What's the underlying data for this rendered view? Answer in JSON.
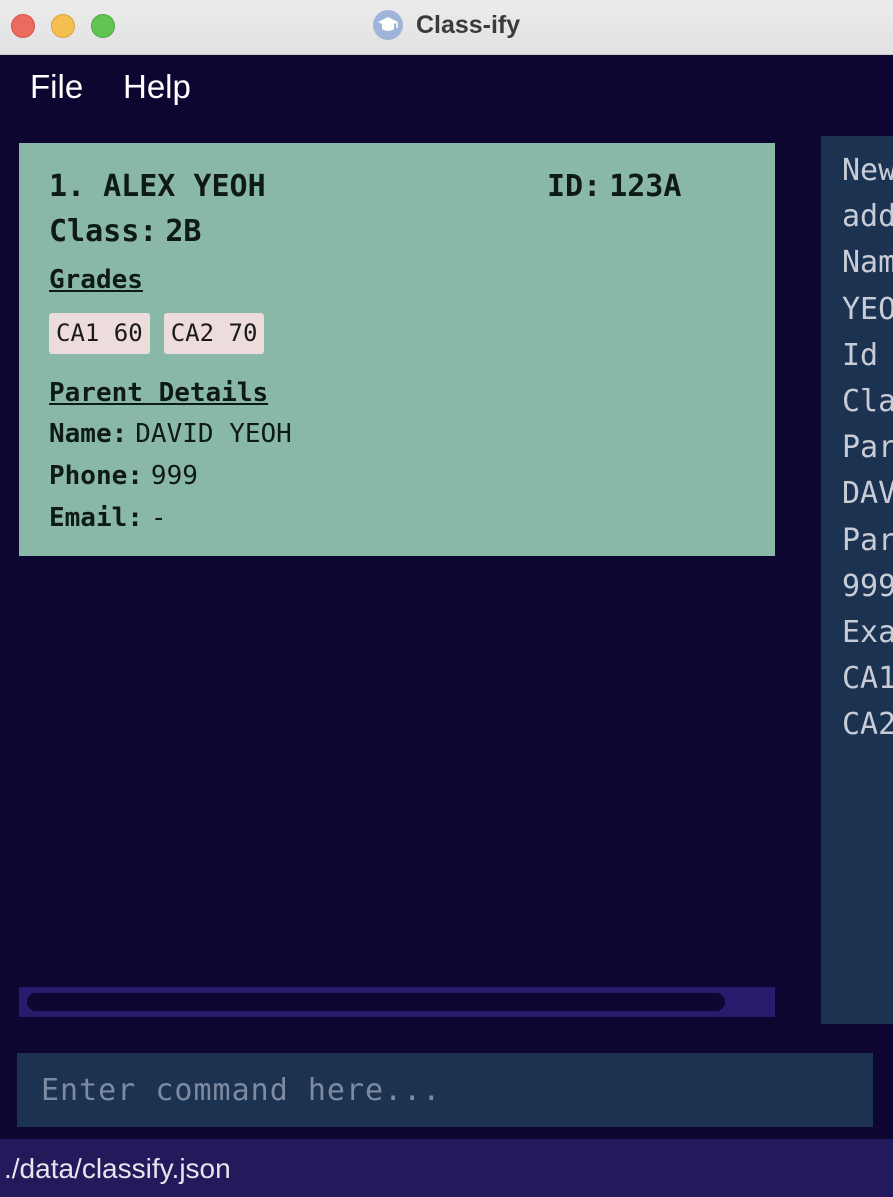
{
  "window": {
    "title": "Class-ify"
  },
  "menu": {
    "file": "File",
    "help": "Help"
  },
  "student": {
    "index": "1.",
    "name": "ALEX YEOH",
    "id_label": "ID:",
    "id": "123A",
    "class_label": "Class:",
    "class": "2B",
    "grades_heading": "Grades",
    "grades": [
      "CA1 60",
      "CA2 70"
    ],
    "parent_heading": "Parent Details",
    "parent_name_label": "Name:",
    "parent_name": "DAVID YEOH",
    "parent_phone_label": "Phone:",
    "parent_phone": "999",
    "parent_email_label": "Email:",
    "parent_email": "-"
  },
  "result": {
    "lines": [
      "New",
      "add",
      "Nam",
      "YEO",
      "Id",
      "Cla",
      "Par",
      "DAV",
      "Par",
      "999",
      "Exa",
      "CA1",
      "CA2"
    ]
  },
  "command": {
    "placeholder": "Enter command here...",
    "value": ""
  },
  "status": {
    "file_path": "./data/classify.json"
  },
  "colors": {
    "background": "#0d0630",
    "card": "#8ab8a8",
    "grade_tag": "#ecdcdc",
    "panel": "#1b3250",
    "status_bar": "#231a5c"
  }
}
